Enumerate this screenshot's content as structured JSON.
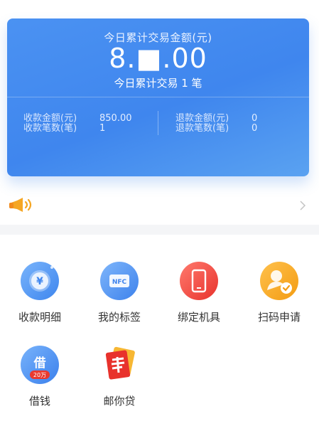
{
  "summary": {
    "title": "今日累计交易金额(元)",
    "amount": "8.■.00",
    "count_text": "今日累计交易 1 笔",
    "receive_amount_label": "收款金额(元)",
    "receive_amount_value": "850.00",
    "receive_count_label": "收款笔数(笔)",
    "receive_count_value": "1",
    "refund_amount_label": "退款金额(元)",
    "refund_amount_value": "0",
    "refund_count_label": "退款笔数(笔)",
    "refund_count_value": "0"
  },
  "notice": {
    "icon": "megaphone-icon",
    "arrow": "chevron-right-icon"
  },
  "grid": [
    {
      "label": "收款明细",
      "icon": "yuan-coin-icon"
    },
    {
      "label": "我的标签",
      "icon": "nfc-icon"
    },
    {
      "label": "绑定机具",
      "icon": "phone-device-icon"
    },
    {
      "label": "扫码申请",
      "icon": "user-check-icon"
    },
    {
      "label": "借钱",
      "icon": "loan-icon",
      "badge": "借",
      "badge_sub": "20万"
    },
    {
      "label": "邮你贷",
      "icon": "postal-loan-icon"
    }
  ],
  "colors": {
    "card_blue": "#4b92f2",
    "orange": "#f5a623",
    "red": "#f0443b"
  }
}
